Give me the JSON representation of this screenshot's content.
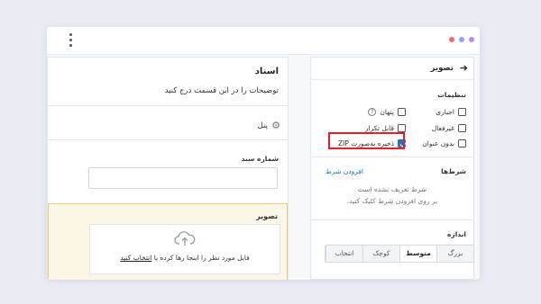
{
  "colors": {
    "dot1": "#f06a6a",
    "dot2": "#8fa3f7",
    "dot3": "#b78ff0",
    "accent": "#1f73c7",
    "highlight": "#e0202a"
  },
  "left_panel": {
    "title": "اسناد",
    "description": "توضیحات را در این قسمت درج کنید",
    "panel_label": "پنل",
    "doc_number_label": "شماره سند",
    "image_section": {
      "label": "تصویر",
      "drop_text": "فایل مورد نظر را اینجا رها کرده یا",
      "drop_link": "انتخاب کنید"
    }
  },
  "right_panel": {
    "title": "تصویر",
    "settings_title": "تنظیمات",
    "checkboxes": {
      "required": {
        "label": "اجباری",
        "checked": false
      },
      "hidden": {
        "label": "پنهان",
        "checked": false
      },
      "disabled": {
        "label": "غیرفعال",
        "checked": false
      },
      "repeatable": {
        "label": "قابل تکرار",
        "checked": false
      },
      "no_title": {
        "label": "بدون عنوان",
        "checked": false
      },
      "save_zip": {
        "label": "ذخیره به‌صورت ZIP",
        "checked": true
      }
    },
    "conditions_title": "شرط‌ها",
    "add_condition": "افزودن شرط",
    "empty_line1": "شرط تعریف نشده است",
    "empty_line2": "بر روی افزودن شرط کلیک کنید.",
    "size_title": "اندازه",
    "size_options": [
      "بزرگ",
      "متوسط",
      "کوچک",
      "انتخاب"
    ],
    "size_selected": "متوسط"
  }
}
